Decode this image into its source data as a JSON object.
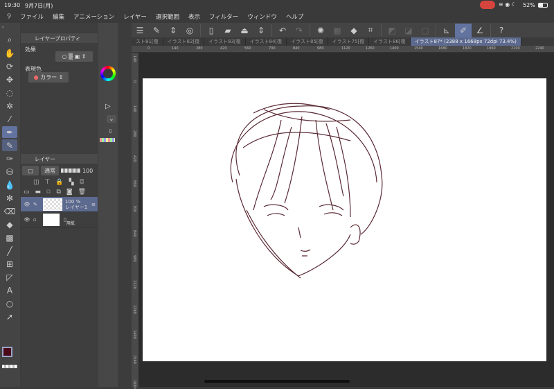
{
  "status": {
    "time": "19:30",
    "date": "9月7日(月)",
    "battery": "52%"
  },
  "menu": [
    "ファイル",
    "編集",
    "アニメーション",
    "レイヤー",
    "選択範囲",
    "表示",
    "フィルター",
    "ウィンドウ",
    "ヘルプ"
  ],
  "tabs": [
    "スト81[復",
    "イラスト82[復",
    "イラスト83[復",
    "イラスト84[復",
    "イラスト85[復",
    "イラスト75[復",
    "イラスト86[復",
    "イラスト87* (2388 x 1668px 72dpi 73.4%)"
  ],
  "hruler": [
    "0",
    "140",
    "280",
    "420",
    "560",
    "700",
    "840",
    "980",
    "1120",
    "1260",
    "1400",
    "1540",
    "1680",
    "1820",
    "1960",
    "2100",
    "2240"
  ],
  "vruler": [
    "140",
    "0",
    "140",
    "280",
    "420",
    "560",
    "700",
    "840",
    "980",
    "1120",
    "1260",
    "1400",
    "1540",
    "1680"
  ],
  "layer_property": {
    "title": "レイヤープロパティ",
    "effect_label": "効果",
    "color_label": "表現色",
    "color_value": "カラー"
  },
  "layers_panel": {
    "title": "レイヤー",
    "blend": "通常",
    "opacity": "100",
    "layers": [
      {
        "opacity": "100 %",
        "mode": "通常",
        "name": "レイヤー1"
      },
      {
        "name": "用紙"
      }
    ]
  },
  "colors": {
    "main": "#4a0a1a",
    "sub": "#3a0508",
    "accent": "#6373a0",
    "mic": "#d6453d",
    "stroke": "#5a2a35"
  }
}
